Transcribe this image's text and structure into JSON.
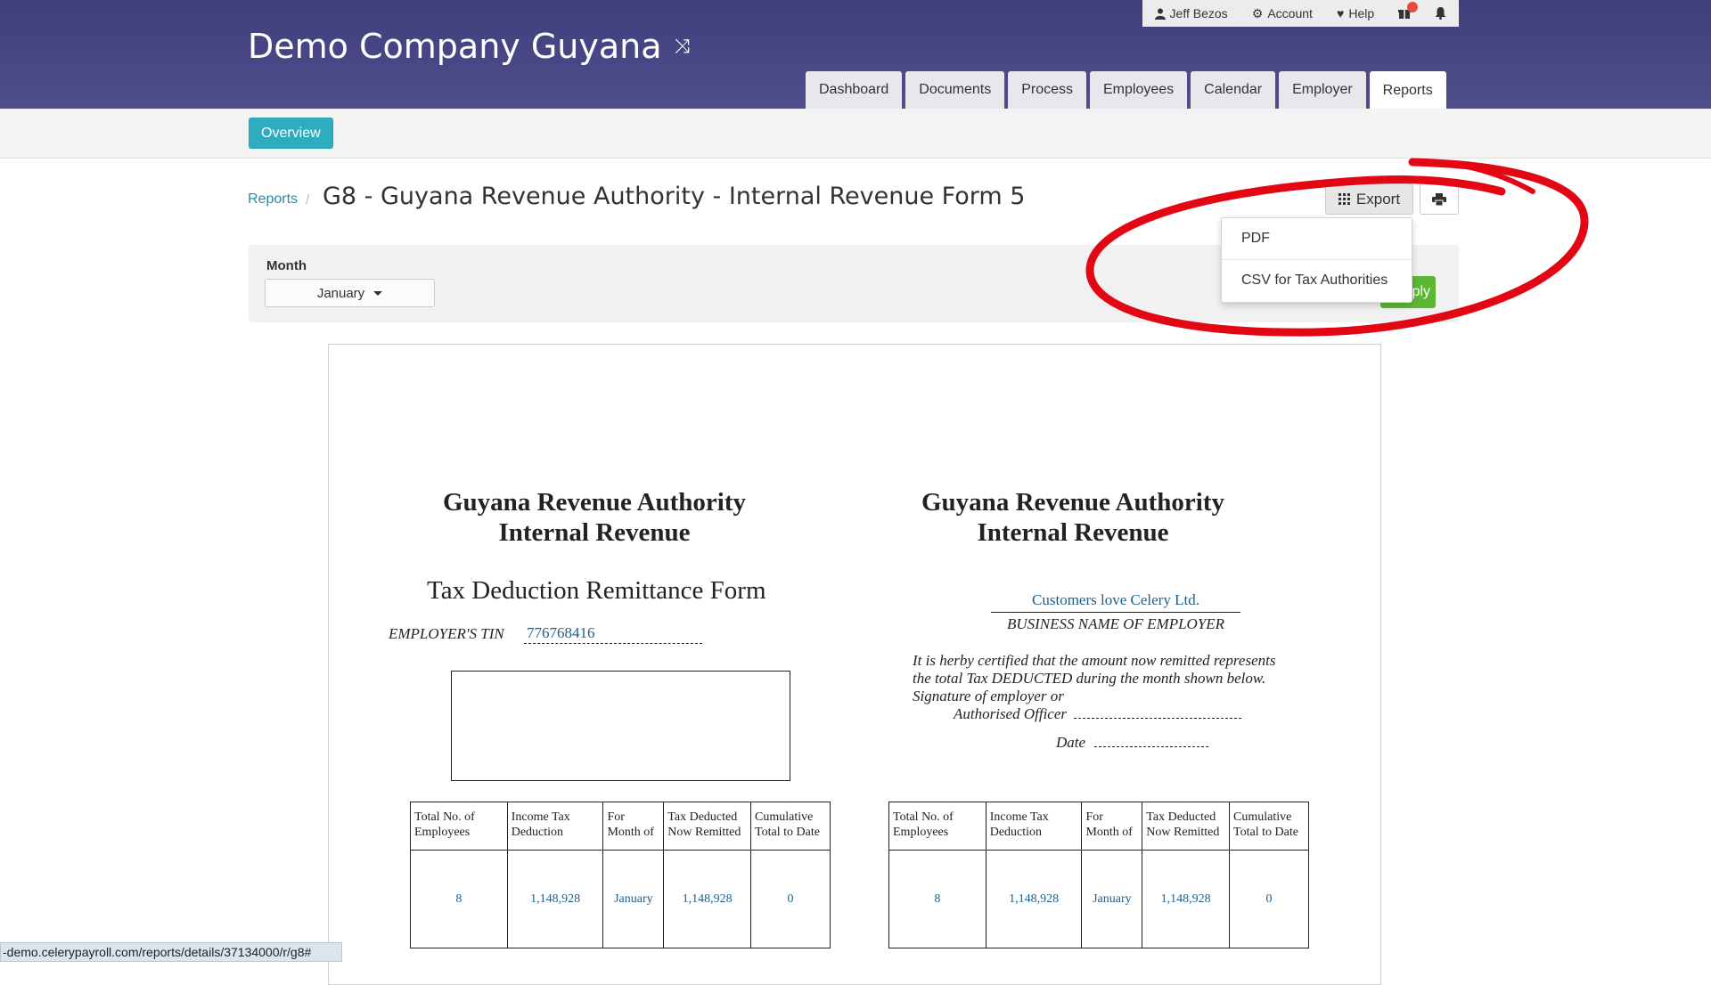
{
  "header": {
    "company_name": "Demo Company Guyana",
    "topbar": {
      "user": "Jeff Bezos",
      "account": "Account",
      "help": "Help"
    },
    "tabs": [
      {
        "label": "Dashboard"
      },
      {
        "label": "Documents"
      },
      {
        "label": "Process"
      },
      {
        "label": "Employees"
      },
      {
        "label": "Calendar"
      },
      {
        "label": "Employer"
      },
      {
        "label": "Reports",
        "active": true
      }
    ]
  },
  "subnav": {
    "overview": "Overview"
  },
  "title_row": {
    "breadcrumb": "Reports",
    "separator": "/",
    "title": "G8 - Guyana Revenue Authority - Internal Revenue Form 5",
    "export_label": "Export"
  },
  "export_menu": {
    "items": [
      "PDF",
      "CSV for Tax Authorities"
    ]
  },
  "filter": {
    "month_label": "Month",
    "month_value": "January",
    "apply_label": "ply"
  },
  "report": {
    "left": {
      "authority_line1": "Guyana Revenue Authority",
      "authority_line2": "Internal Revenue",
      "form_title": "Tax Deduction Remittance Form",
      "tin_label": "EMPLOYER'S TIN",
      "tin_value": "776768416"
    },
    "right": {
      "authority_line1": "Guyana Revenue Authority",
      "authority_line2": "Internal Revenue",
      "business_name": "Customers love Celery Ltd.",
      "business_label": "BUSINESS NAME OF EMPLOYER",
      "cert_line1": "It is herby certified that the amount now remitted represents",
      "cert_line2": "the total Tax DEDUCTED during the month shown below.",
      "cert_line3": "Signature of employer or",
      "cert_line4": "Authorised Officer",
      "date_label": "Date"
    },
    "table": {
      "headers": [
        [
          "Total No. of",
          "Employees"
        ],
        [
          "Income Tax",
          "Deduction"
        ],
        [
          "For",
          "Month of"
        ],
        [
          "Tax Deducted",
          "Now Remitted"
        ],
        [
          "Cumulative",
          "Total to Date"
        ]
      ],
      "values": [
        "8",
        "1,148,928",
        "January",
        "1,148,928",
        "0"
      ]
    }
  },
  "status_bar": {
    "url": "-demo.celerypayroll.com/reports/details/37134000/r/g8#"
  },
  "colors": {
    "header": "#4a4888",
    "overview": "#2eadc0",
    "apply": "#5cb833",
    "annotation": "#e30613",
    "link": "#2a8aa6"
  }
}
